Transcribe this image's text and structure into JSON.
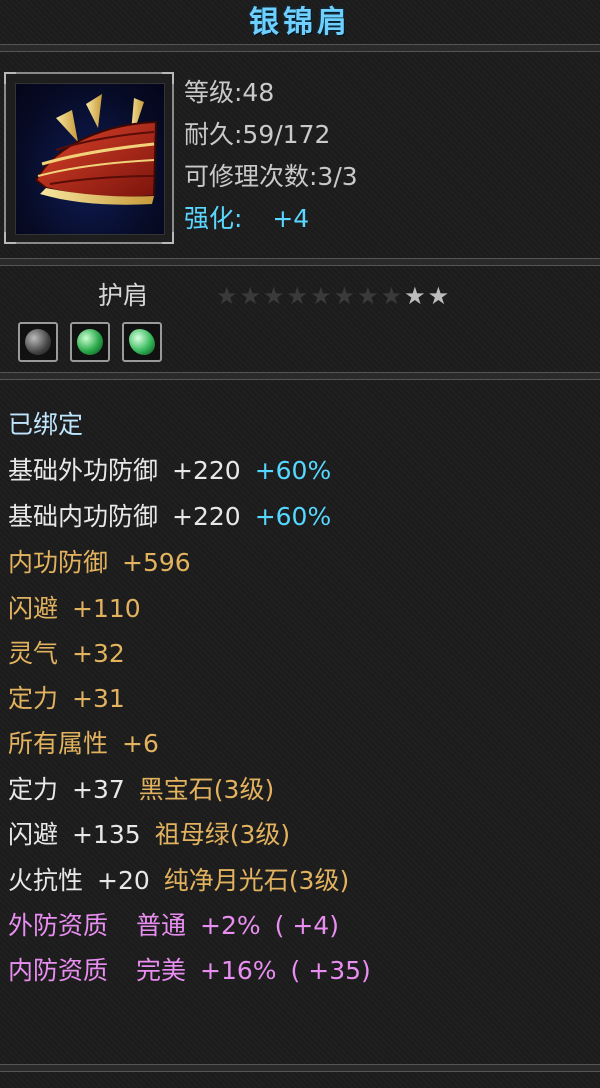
{
  "item": {
    "name": "银锦肩",
    "level": "等级:48",
    "durability": "耐久:59/172",
    "repairs": "可修理次数:3/3",
    "enhance_label": "强化:",
    "enhance_value": "+4",
    "type": "护肩",
    "stars": {
      "total": 10,
      "lit": 2
    },
    "sockets": [
      "black-gem",
      "green-gem",
      "green-gem"
    ],
    "bound": "已绑定"
  },
  "base_stats": [
    {
      "name": "基础外功防御",
      "value": "+220",
      "bonus": "+60%"
    },
    {
      "name": "基础内功防御",
      "value": "+220",
      "bonus": "+60%"
    }
  ],
  "attributes": [
    {
      "name": "内功防御",
      "value": "+596"
    },
    {
      "name": "闪避",
      "value": "+110"
    },
    {
      "name": "灵气",
      "value": "+32"
    },
    {
      "name": "定力",
      "value": "+31"
    },
    {
      "name": "所有属性",
      "value": "+6"
    }
  ],
  "gem_stats": [
    {
      "name": "定力",
      "value": "+37",
      "gem": "黑宝石(3级)"
    },
    {
      "name": "闪避",
      "value": "+135",
      "gem": "祖母绿(3级)"
    },
    {
      "name": "火抗性",
      "value": "+20",
      "gem": "纯净月光石(3级)"
    }
  ],
  "qualities": [
    {
      "name": "外防资质",
      "grade": "普通",
      "pct": "+2%",
      "value": "( +4)"
    },
    {
      "name": "内防资质",
      "grade": "完美",
      "pct": "+16%",
      "value": "( +35)"
    }
  ],
  "colors": {
    "title": "#6fd0ff",
    "enhance": "#5ad6ff",
    "gold": "#e2b25f",
    "cyan": "#55d7ff",
    "pink": "#e88ef0"
  }
}
